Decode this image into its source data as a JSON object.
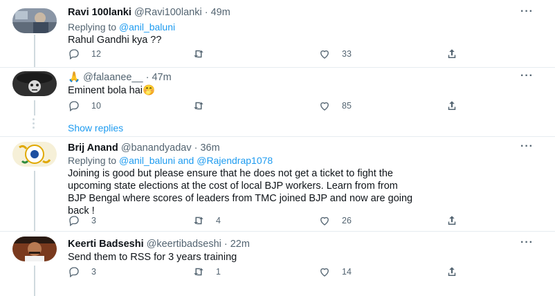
{
  "tweets": [
    {
      "name": "Ravi 100lanki",
      "handle": "@Ravi100lanki · 49m",
      "reply_prefix": "Replying to ",
      "reply_to": "@anil_baluni",
      "text": "Rahul Gandhi kya ??",
      "replies": "12",
      "retweets": "",
      "likes": "33"
    },
    {
      "name": "🙏",
      "handle": "@falaanee__ · 47m",
      "text": "Eminent bola hai🤭",
      "replies": "10",
      "retweets": "",
      "likes": "85"
    },
    {
      "name": "Brij Anand",
      "handle": "@banandyadav · 36m",
      "reply_prefix": "Replying to ",
      "reply_to": "@anil_baluni and @Rajendrap1078",
      "text_lines": [
        "Joining is good but please ensure that he does not get a ticket to fight the",
        "upcoming state elections at the cost of local BJP workers. Learn from from",
        "BJP Bengal where scores of leaders from TMC joined BJP and now are going",
        "back !"
      ],
      "replies": "3",
      "retweets": "4",
      "likes": "26"
    },
    {
      "name": "Keerti Badseshi",
      "handle": "@keertibadseshi · 22m",
      "text": "Send them to RSS for 3 years training",
      "replies": "3",
      "retweets": "1",
      "likes": "14"
    }
  ],
  "show_replies": "Show replies",
  "more_label": "···",
  "icons": [
    "reply-icon",
    "retweet-icon",
    "like-icon",
    "share-icon",
    "more-icon"
  ],
  "colors": {
    "link": "#1d9bf0",
    "muted": "#536471",
    "divider": "#e6ecf0"
  }
}
